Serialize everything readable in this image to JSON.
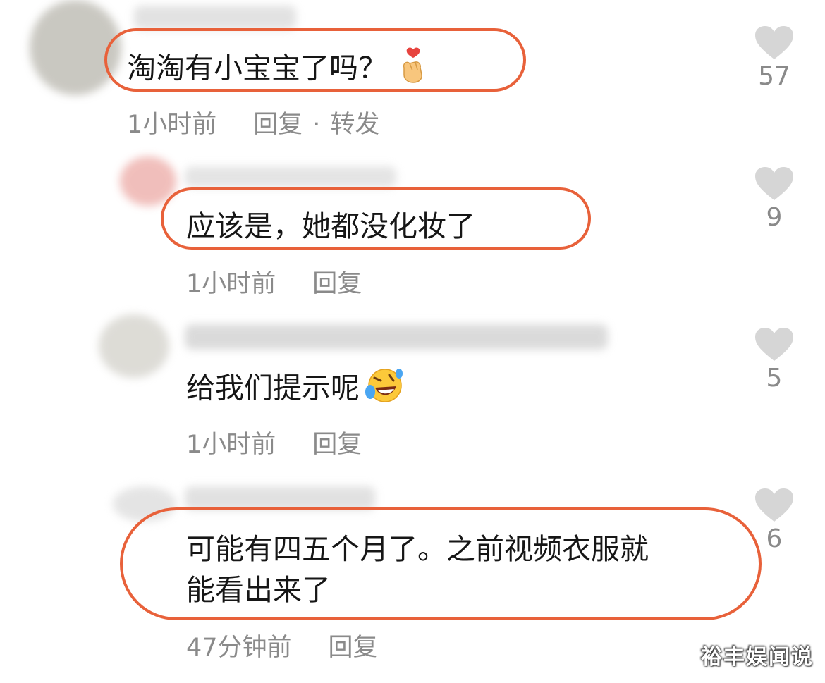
{
  "comments": [
    {
      "text": "淘淘有小宝宝了吗？",
      "emoji": "finger-heart-icon",
      "time": "1小时前",
      "reply": "回复",
      "forward": "转发",
      "dot": "·",
      "likes": "57"
    },
    {
      "text": "应该是，她都没化妆了",
      "time": "1小时前",
      "reply": "回复",
      "likes": "9"
    },
    {
      "text": "给我们提示呢",
      "emoji": "rolling-laughing-icon",
      "time": "1小时前",
      "reply": "回复",
      "likes": "5"
    },
    {
      "text_line1": "可能有四五个月了。之前视频衣服就",
      "text_line2": "能看出来了",
      "time": "47分钟前",
      "reply": "回复",
      "likes": "6"
    }
  ],
  "watermark": "裕丰娱闻说",
  "colors": {
    "highlight": "#e8613a",
    "meta": "#8a8a8a",
    "heart": "#d6d6d6"
  }
}
